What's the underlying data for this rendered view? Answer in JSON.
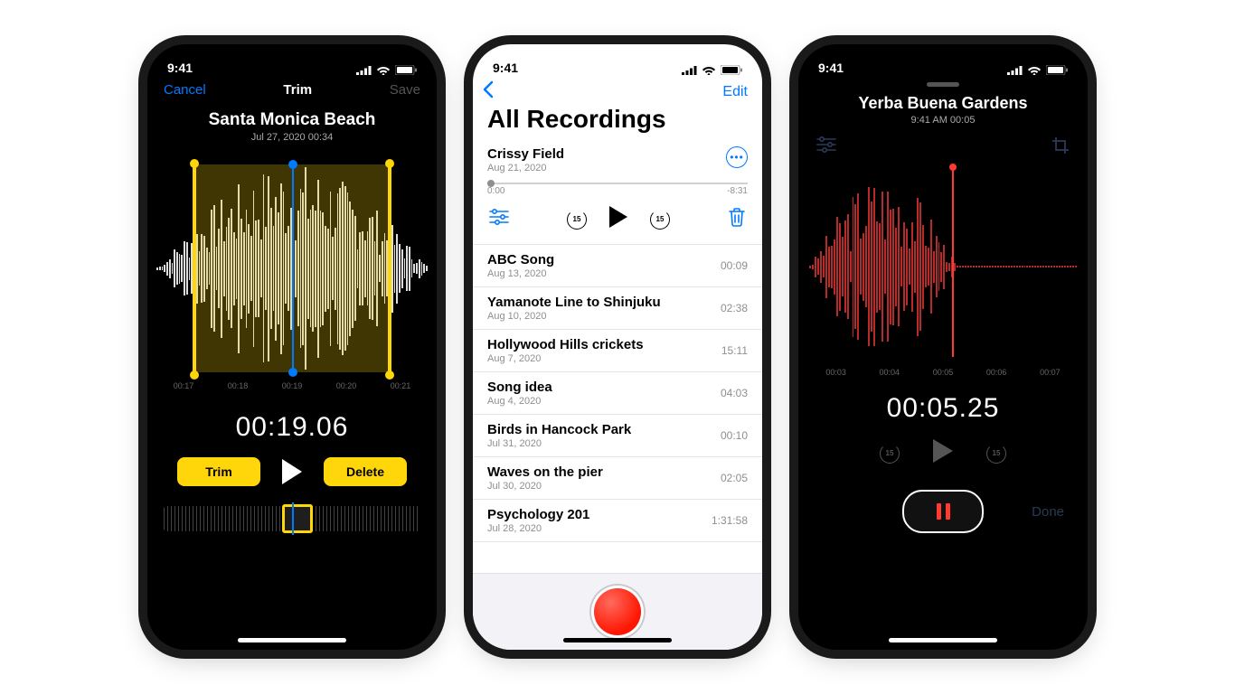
{
  "status_time": "9:41",
  "trim": {
    "cancel": "Cancel",
    "nav_title": "Trim",
    "save": "Save",
    "title": "Santa Monica Beach",
    "subtitle": "Jul 27, 2020  00:34",
    "ticks": [
      "00:17",
      "00:18",
      "00:19",
      "00:20",
      "00:21"
    ],
    "timecode": "00:19.06",
    "trim_btn": "Trim",
    "delete_btn": "Delete"
  },
  "list": {
    "edit": "Edit",
    "heading": "All Recordings",
    "expanded": {
      "title": "Crissy Field",
      "date": "Aug 21, 2020",
      "start": "0:00",
      "end": "-8:31",
      "skip": "15"
    },
    "items": [
      {
        "title": "ABC Song",
        "date": "Aug 13, 2020",
        "dur": "00:09"
      },
      {
        "title": "Yamanote Line to Shinjuku",
        "date": "Aug 10, 2020",
        "dur": "02:38"
      },
      {
        "title": "Hollywood Hills crickets",
        "date": "Aug 7, 2020",
        "dur": "15:11"
      },
      {
        "title": "Song idea",
        "date": "Aug 4, 2020",
        "dur": "04:03"
      },
      {
        "title": "Birds in Hancock Park",
        "date": "Jul 31, 2020",
        "dur": "00:10"
      },
      {
        "title": "Waves on the pier",
        "date": "Jul 30, 2020",
        "dur": "02:05"
      },
      {
        "title": "Psychology 201",
        "date": "Jul 28, 2020",
        "dur": "1:31:58"
      }
    ]
  },
  "rec": {
    "title": "Yerba Buena Gardens",
    "subtitle": "9:41 AM  00:05",
    "ticks": [
      "00:03",
      "00:04",
      "00:05",
      "00:06",
      "00:07"
    ],
    "timecode": "00:05.25",
    "skip": "15",
    "done": "Done"
  }
}
